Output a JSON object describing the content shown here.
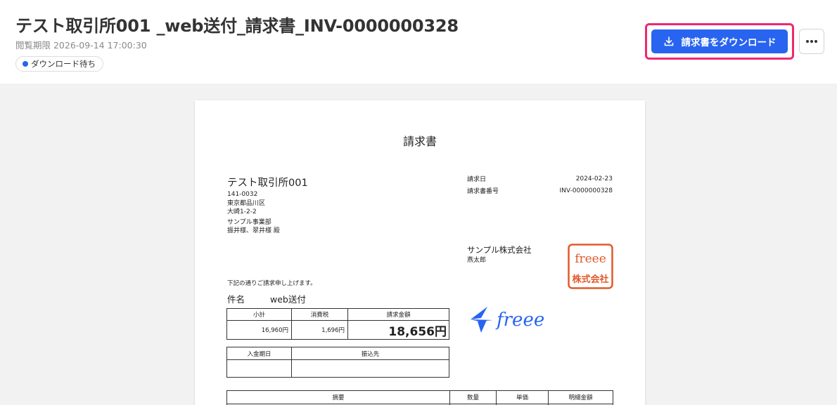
{
  "header": {
    "title": "テスト取引所001 _web送付_請求書_INV-0000000328",
    "deadline": "閲覧期限 2026-09-14 17:00:30",
    "status": "ダウンロード待ち",
    "download_label": "請求書をダウンロード",
    "more_icon": "more-horizontal-icon",
    "download_icon": "download-icon",
    "accent_color": "#2864f0",
    "highlight_color": "#f0286e"
  },
  "invoice": {
    "doc_title": "請求書",
    "client": {
      "name": "テスト取引所001",
      "postal": "141-0032",
      "address1": "東京都品川区",
      "address2": "大崎1-2-2",
      "department": "サンプル事業部",
      "contacts": "振井様、翠井様 殿"
    },
    "meta": {
      "date_label": "請求日",
      "date_value": "2024-02-23",
      "number_label": "請求書番号",
      "number_value": "INV-0000000328"
    },
    "seller": {
      "name": "サンプル株式会社",
      "person": "燕太郎"
    },
    "seal_text_top": "freee",
    "seal_text_bottom": "株式会社",
    "logo_text": "freee",
    "note": "下記の通りご請求申し上げます。",
    "subject_label": "件名",
    "subject_value": "web送付",
    "amounts": {
      "subtotal_label": "小計",
      "tax_label": "消費税",
      "total_label": "請求金額",
      "subtotal": "16,960円",
      "tax": "1,696円",
      "total": "18,656円"
    },
    "payment": {
      "due_label": "入金期日",
      "account_label": "振込先",
      "due_value": "",
      "account_value": ""
    },
    "items_header": {
      "description": "摘要",
      "quantity": "数量",
      "unit_price": "単価",
      "amount": "明細金額"
    }
  }
}
